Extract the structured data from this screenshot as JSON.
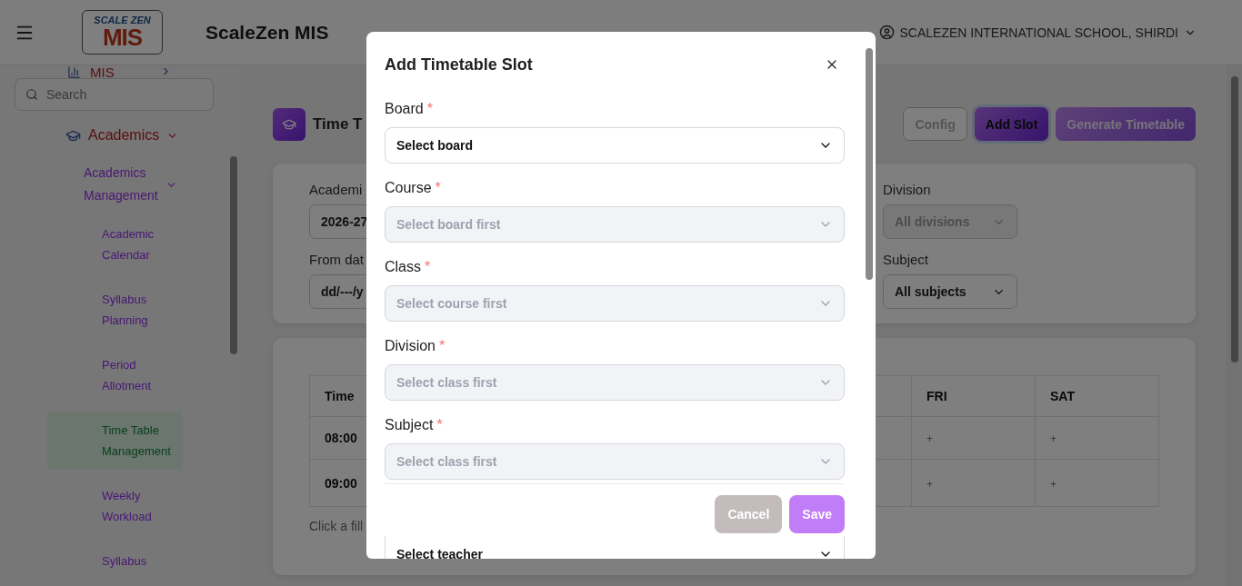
{
  "header": {
    "logo": {
      "top": "SCALE ZEN",
      "bottom": "MIS"
    },
    "app_title": "ScaleZen MIS",
    "school": "SCALEZEN INTERNATIONAL SCHOOL, SHIRDI"
  },
  "sidebar": {
    "search": {
      "placeholder": "Search"
    },
    "items": [
      {
        "label": "MIS",
        "expanded": false
      },
      {
        "label": "Academics",
        "expanded": true,
        "children": [
          {
            "label": "Academics Management",
            "expanded": true,
            "children": [
              {
                "label": "Academic Calendar",
                "selected": false
              },
              {
                "label": "Syllabus Planning",
                "selected": false
              },
              {
                "label": "Period Allotment",
                "selected": false
              },
              {
                "label": "Time Table Management",
                "selected": true
              },
              {
                "label": "Weekly Workload",
                "selected": false
              },
              {
                "label": "Syllabus",
                "selected": false
              }
            ]
          }
        ]
      }
    ]
  },
  "page": {
    "title": "Time T",
    "buttons": [
      {
        "label": "Config",
        "kind": "outline",
        "disabled": true
      },
      {
        "label": "Add Slot",
        "kind": "primary",
        "disabled": false
      },
      {
        "label": "Generate Timetable",
        "kind": "primary",
        "disabled": true
      }
    ],
    "filters": {
      "left": [
        {
          "label": "Academi",
          "value": "2026-27"
        },
        {
          "label": "From dat",
          "value": "dd/---/y"
        }
      ],
      "right": [
        {
          "label": "Division",
          "value": "All divisions",
          "disabled": true
        },
        {
          "label": "Subject",
          "value": "All subjects",
          "disabled": false
        }
      ]
    },
    "table": {
      "columns": [
        "Time",
        "FRI",
        "SAT"
      ],
      "rows": [
        {
          "cells": [
            "08:00",
            "+",
            "+"
          ]
        },
        {
          "cells": [
            "09:00",
            "+",
            "+"
          ]
        }
      ]
    },
    "hint": "Click a fill"
  },
  "modal": {
    "title": "Add Timetable Slot",
    "fields": [
      {
        "label": "Board",
        "required": true,
        "placeholder": "Select board",
        "disabled": false
      },
      {
        "label": "Course",
        "required": true,
        "placeholder": "Select board first",
        "disabled": true
      },
      {
        "label": "Class",
        "required": true,
        "placeholder": "Select course first",
        "disabled": true
      },
      {
        "label": "Division",
        "required": true,
        "placeholder": "Select class first",
        "disabled": true
      },
      {
        "label": "Subject",
        "required": true,
        "placeholder": "Select class first",
        "disabled": true
      }
    ],
    "required_mark": "*",
    "buttons": [
      {
        "label": "Cancel",
        "kind": "secondary"
      },
      {
        "label": "Save",
        "kind": "primary"
      }
    ],
    "teacher": {
      "placeholder": "Select teacher",
      "disabled": false
    }
  }
}
